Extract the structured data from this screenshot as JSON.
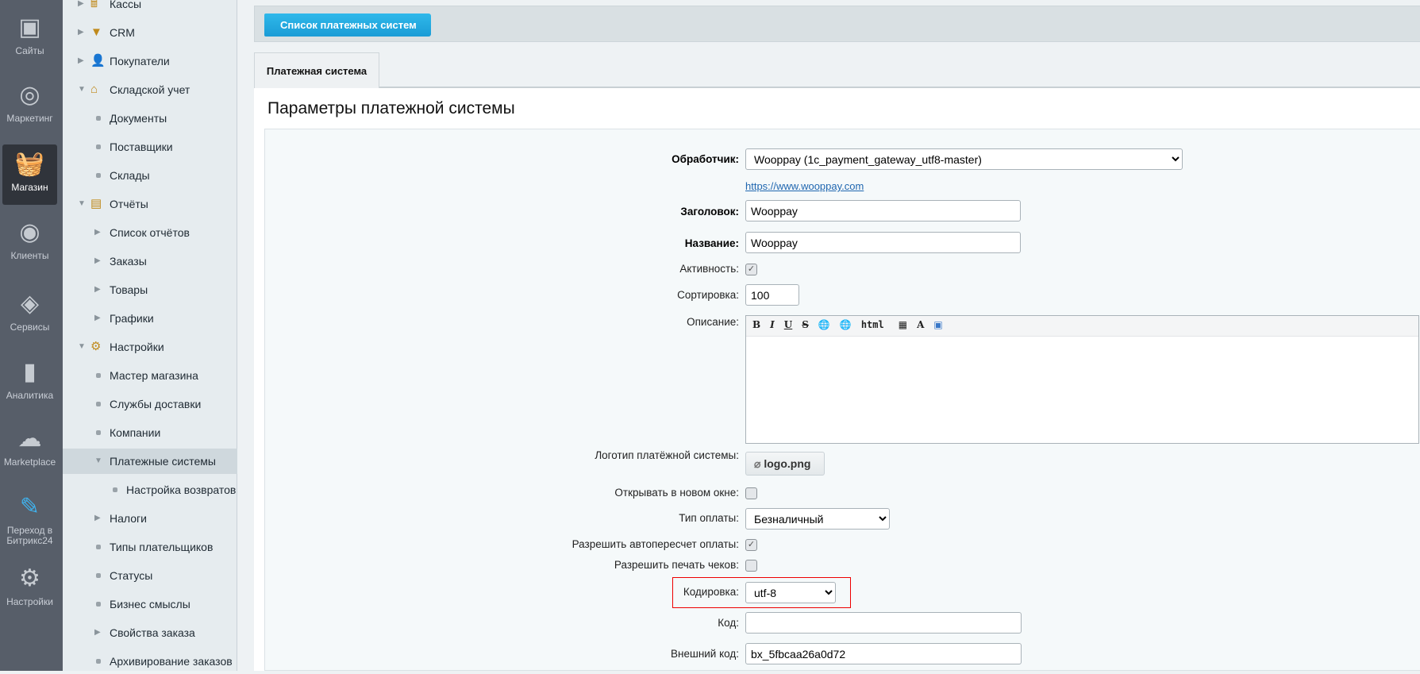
{
  "left_bar": [
    {
      "label": "Сайты",
      "icon": "calendar-24-icon"
    },
    {
      "label": "Маркетинг",
      "icon": "target-icon"
    },
    {
      "label": "Магазин",
      "icon": "basket-icon",
      "active": true
    },
    {
      "label": "Клиенты",
      "icon": "clients-24-icon"
    },
    {
      "label": "Сервисы",
      "icon": "layers-icon"
    },
    {
      "label": "Аналитика",
      "icon": "bar-chart-icon"
    },
    {
      "label": "Marketplace",
      "icon": "cloud-download-icon"
    },
    {
      "label": "Переход в Битрикс24",
      "icon": "magic-wand-icon"
    },
    {
      "label": "Настройки",
      "icon": "gear-icon"
    }
  ],
  "menu": [
    {
      "label": "Кассы",
      "level": 0,
      "marker": "arrow-right",
      "icon": "cash-register-icon"
    },
    {
      "label": "CRM",
      "level": 0,
      "marker": "arrow-right",
      "icon": "funnel-icon"
    },
    {
      "label": "Покупатели",
      "level": 0,
      "marker": "arrow-right",
      "icon": "buyers-icon"
    },
    {
      "label": "Складской учет",
      "level": 0,
      "marker": "arrow-down",
      "icon": "warehouse-icon"
    },
    {
      "label": "Документы",
      "level": 1,
      "marker": "dot"
    },
    {
      "label": "Поставщики",
      "level": 1,
      "marker": "dot"
    },
    {
      "label": "Склады",
      "level": 1,
      "marker": "dot"
    },
    {
      "label": "Отчёты",
      "level": 0,
      "marker": "arrow-down",
      "icon": "report-icon"
    },
    {
      "label": "Список отчётов",
      "level": 1,
      "marker": "arrow-right"
    },
    {
      "label": "Заказы",
      "level": 1,
      "marker": "arrow-right"
    },
    {
      "label": "Товары",
      "level": 1,
      "marker": "arrow-right"
    },
    {
      "label": "Графики",
      "level": 1,
      "marker": "arrow-right"
    },
    {
      "label": "Настройки",
      "level": 0,
      "marker": "arrow-down",
      "icon": "settings-bag-icon"
    },
    {
      "label": "Мастер магазина",
      "level": 1,
      "marker": "dot"
    },
    {
      "label": "Службы доставки",
      "level": 1,
      "marker": "dot"
    },
    {
      "label": "Компании",
      "level": 1,
      "marker": "dot"
    },
    {
      "label": "Платежные системы",
      "level": 1,
      "marker": "arrow-down",
      "selected": true
    },
    {
      "label": "Настройка возвратов",
      "level": 2,
      "marker": "dot"
    },
    {
      "label": "Налоги",
      "level": 1,
      "marker": "arrow-right"
    },
    {
      "label": "Типы плательщиков",
      "level": 1,
      "marker": "dot"
    },
    {
      "label": "Статусы",
      "level": 1,
      "marker": "dot"
    },
    {
      "label": "Бизнес смыслы",
      "level": 1,
      "marker": "dot"
    },
    {
      "label": "Свойства заказа",
      "level": 1,
      "marker": "arrow-right"
    },
    {
      "label": "Архивирование заказов",
      "level": 1,
      "marker": "dot"
    }
  ],
  "toolbar": {
    "back_label": "Список платежных систем"
  },
  "tabs": [
    {
      "label": "Платежная система"
    }
  ],
  "panel_title": "Параметры платежной системы",
  "form": {
    "handler": {
      "label": "Обработчик:",
      "value": "Wooppay (1c_payment_gateway_utf8-master)",
      "link": "https://www.wooppay.com"
    },
    "header": {
      "label": "Заголовок:",
      "value": "Wooppay"
    },
    "name": {
      "label": "Название:",
      "value": "Wooppay"
    },
    "active": {
      "label": "Активность:",
      "checked": true
    },
    "sort": {
      "label": "Сортировка:",
      "value": "100"
    },
    "description": {
      "label": "Описание:",
      "toolbar": [
        "B",
        "I",
        "U",
        "S",
        "link",
        "unlink",
        "html",
        "paste",
        "font",
        "image"
      ],
      "toolbar_html": "html"
    },
    "logo": {
      "label": "Логотип платёжной системы:",
      "file": "logo.png"
    },
    "new_window": {
      "label": "Открывать в новом окне:",
      "checked": false
    },
    "pay_type": {
      "label": "Тип оплаты:",
      "value": "Безналичный"
    },
    "autorecalc": {
      "label": "Разрешить автопересчет оплаты:",
      "checked": true
    },
    "print_checks": {
      "label": "Разрешить печать чеков:",
      "checked": false
    },
    "encoding": {
      "label": "Кодировка:",
      "value": "utf-8",
      "highlight_color": "#e00000"
    },
    "code": {
      "label": "Код:",
      "value": ""
    },
    "external_code": {
      "label": "Внешний код:",
      "value": "bx_5fbcaa26a0d72"
    }
  }
}
